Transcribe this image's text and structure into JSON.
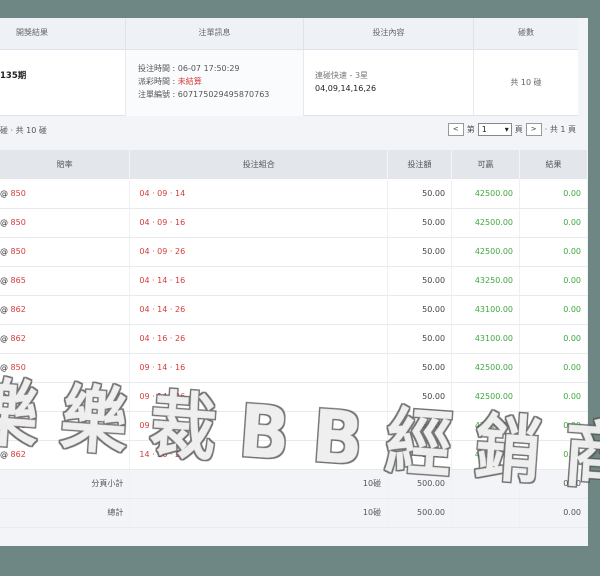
{
  "summary_header": {
    "col1": "開獎結果",
    "col2": "注單訊息",
    "col3": "投注內容",
    "col4": "碰數"
  },
  "summary_row": {
    "period": "135期",
    "bet_time": "投注時間 : 06-07 17:50:29",
    "draw_time_label": "派彩時間 : ",
    "draw_time_value": "未結算",
    "order_no": "注單編號 : 607175029495870763",
    "bet_type": "連碰快速 - 3星",
    "bet_numbers": "04,09,14,16,26",
    "count": "共 10 碰"
  },
  "pager": {
    "left_text": "碰 · 共 10 碰",
    "prev": "<",
    "page_prefix": "第",
    "page_value": "1",
    "page_suffix": "頁",
    "next": ">",
    "total": "· 共 1 頁"
  },
  "table": {
    "headers": [
      "賠率",
      "投注組合",
      "投注額",
      "可贏",
      "結果"
    ],
    "rows": [
      {
        "odds_prefix": "@ ",
        "odds": "850",
        "combo": "04 · 09 · 14",
        "amount": "50.00",
        "win": "42500.00",
        "result": "0.00"
      },
      {
        "odds_prefix": "@ ",
        "odds": "850",
        "combo": "04 · 09 · 16",
        "amount": "50.00",
        "win": "42500.00",
        "result": "0.00"
      },
      {
        "odds_prefix": "@ ",
        "odds": "850",
        "combo": "04 · 09 · 26",
        "amount": "50.00",
        "win": "42500.00",
        "result": "0.00"
      },
      {
        "odds_prefix": "@ ",
        "odds": "865",
        "combo": "04 · 14 · 16",
        "amount": "50.00",
        "win": "43250.00",
        "result": "0.00"
      },
      {
        "odds_prefix": "@ ",
        "odds": "862",
        "combo": "04 · 14 · 26",
        "amount": "50.00",
        "win": "43100.00",
        "result": "0.00"
      },
      {
        "odds_prefix": "@ ",
        "odds": "862",
        "combo": "04 · 16 · 26",
        "amount": "50.00",
        "win": "43100.00",
        "result": "0.00"
      },
      {
        "odds_prefix": "@ ",
        "odds": "850",
        "combo": "09 · 14 · 16",
        "amount": "50.00",
        "win": "42500.00",
        "result": "0.00"
      },
      {
        "odds_prefix": "@ ",
        "odds": "850",
        "combo": "09 · 14 · 26",
        "amount": "50.00",
        "win": "42500.00",
        "result": "0.00"
      },
      {
        "odds_prefix": "@ ",
        "odds": "850",
        "combo": "09 · 16 · 26",
        "amount": "50.00",
        "win": "42500.00",
        "result": "0.00"
      },
      {
        "odds_prefix": "@ ",
        "odds": "862",
        "combo": "14 · 16 · 26",
        "amount": "50.00",
        "win": "43100.00",
        "result": "0.00"
      }
    ],
    "subtotal": {
      "label": "分頁小計",
      "count": "10碰",
      "amount": "500.00",
      "result": "0.00"
    },
    "total": {
      "label": "總計",
      "count": "10碰",
      "amount": "500.00",
      "result": "0.00"
    }
  },
  "watermark_text": "樂 樂 裁  B B 經 銷 商",
  "colors": {
    "accent_red": "#d83b3b",
    "win_green": "#3fa83f",
    "background": "#6f8784"
  }
}
